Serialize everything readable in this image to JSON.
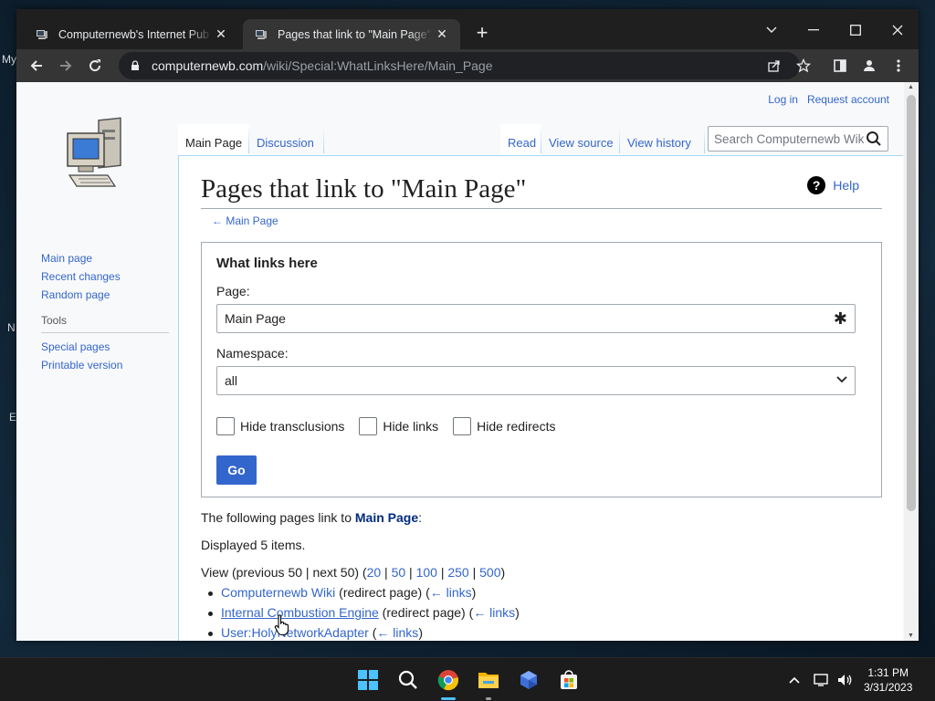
{
  "browser": {
    "tabs": [
      {
        "title": "Computernewb's Internet Pub Hub",
        "active": false
      },
      {
        "title": "Pages that link to \"Main Page\" - Computernewb Wiki",
        "active": true
      }
    ],
    "url_host": "computernewb.com",
    "url_path": "/wiki/Special:WhatLinksHere/Main_Page"
  },
  "wiki": {
    "personal": {
      "login": "Log in",
      "request": "Request account"
    },
    "tabs": {
      "main": "Main Page",
      "discussion": "Discussion",
      "read": "Read",
      "view_source": "View source",
      "view_history": "View history"
    },
    "search_placeholder": "Search Computernewb Wiki",
    "sidebar": {
      "nav": [
        "Main page",
        "Recent changes",
        "Random page"
      ],
      "tools_heading": "Tools",
      "tools": [
        "Special pages",
        "Printable version"
      ]
    },
    "title": "Pages that link to \"Main Page\"",
    "help": "Help",
    "backlink": "← Main Page",
    "form": {
      "legend": "What links here",
      "page_label": "Page:",
      "page_value": "Main Page",
      "namespace_label": "Namespace:",
      "namespace_value": "all",
      "checks": [
        "Hide transclusions",
        "Hide links",
        "Hide redirects"
      ],
      "go": "Go"
    },
    "following_prefix": "The following pages link to ",
    "following_target": "Main Page",
    "following_suffix": ":",
    "displayed": "Displayed 5 items.",
    "view_line": {
      "prefix": "View (previous 50 | next 50) (",
      "sizes": [
        "20",
        "50",
        "100",
        "250",
        "500"
      ],
      "suffix": ")"
    },
    "results": [
      {
        "page": "Computernewb Wiki",
        "note": " (redirect page)  (",
        "links": "← links",
        "close": ")"
      },
      {
        "page": "Internal Combustion Engine",
        "note": " (redirect page)  (",
        "links": "← links",
        "close": ")"
      },
      {
        "page": "User:HolyNetworkAdapter",
        "note": "  (",
        "links": "← links",
        "close": ")"
      }
    ]
  },
  "taskbar": {
    "apps": [
      "windows-start",
      "search",
      "chrome",
      "file-explorer",
      "bing-app",
      "microsoft-store"
    ],
    "time": "1:31 PM",
    "date": "3/31/2023"
  },
  "desktop": {
    "fragments": [
      "My",
      "N",
      "E"
    ]
  }
}
